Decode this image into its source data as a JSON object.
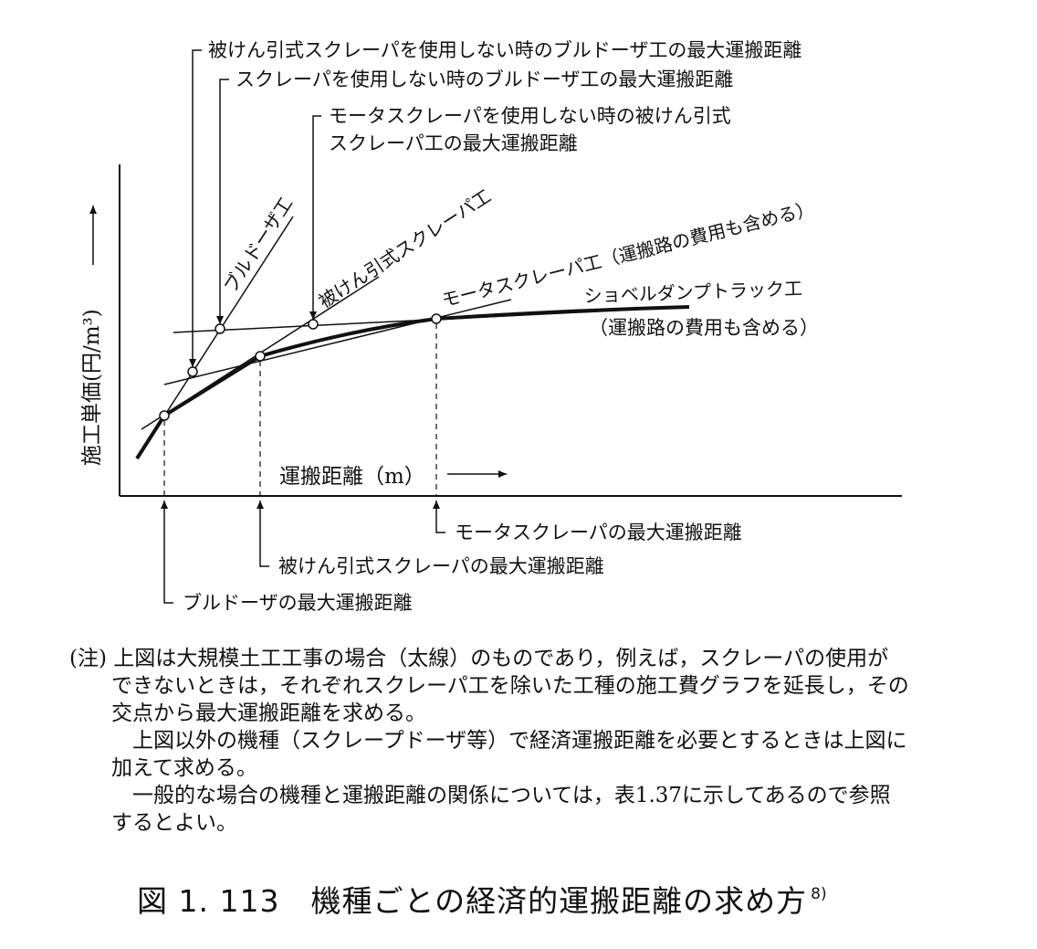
{
  "diagram": {
    "y_axis_label": "施工単価(円/m³)",
    "x_axis_label": "運搬距離（m）",
    "line_labels": {
      "bulldozer": "ブルドーザ工",
      "towed_scraper": "被けん引式スクレーパ工",
      "motor_scraper": "モータスクレーパ工（運搬路の費用も含める）",
      "shovel_dump_line1": "ショベルダンプトラック工",
      "shovel_dump_line2": "（運搬路の費用も含める）"
    },
    "top_callouts": {
      "c1": "被けん引式スクレーパを使用しない時のブルドーザ工の最大運搬距離",
      "c2": "スクレーパを使用しない時のブルドーザ工の最大運搬距離",
      "c3_line1": "モータスクレーパを使用しない時の被けん引式",
      "c3_line2": "スクレーパ工の最大運搬距離"
    },
    "bottom_callouts": {
      "b1": "モータスクレーパの最大運搬距離",
      "b2": "被けん引式スクレーパの最大運搬距離",
      "b3": "ブルドーザの最大運搬距離"
    }
  },
  "note": {
    "p1": "(注) 上図は大規模土工工事の場合（太線）のものであり，例えば，スクレーパの使用ができないときは，それぞれスクレーパ工を除いた工種の施工費グラフを延長し，その交点から最大運搬距離を求める。",
    "p2": "上図以外の機種（スクレープドーザ等）で経済運搬距離を必要とするときは上図に加えて求める。",
    "p3": "一般的な場合の機種と運搬距離の関係については，表1.37に示してあるので参照するとよい。"
  },
  "caption": {
    "text": "図 1. 113　機種ごとの経済的運搬距離の求め方",
    "ref": "8)"
  }
}
